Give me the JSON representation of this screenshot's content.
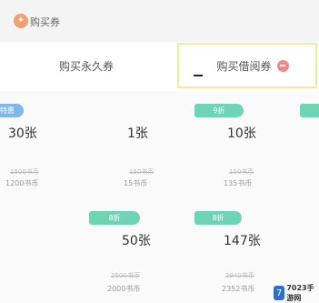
{
  "header": {
    "icon_glyph": "✦",
    "title": "购买券"
  },
  "tabs": [
    {
      "label": "购买永久券"
    },
    {
      "label": "购买借阅券"
    }
  ],
  "options": [
    {
      "badge": "特惠",
      "count": "30张",
      "original": "1500书币",
      "price": "1200书币"
    },
    {
      "badge": "",
      "count": "1张",
      "original": "150书币",
      "price": "15书币"
    },
    {
      "badge": "9折",
      "count": "10张",
      "original": "150书币",
      "price": "135书币"
    },
    {
      "badge": "",
      "count": "",
      "original": "",
      "price": ""
    },
    {
      "badge": "8折",
      "count": "50张",
      "original": "2500书币",
      "price": "2000书币"
    },
    {
      "badge": "8折",
      "count": "147张",
      "original": "2940书币",
      "price": "2352书币"
    }
  ],
  "watermark": {
    "icon_glyph": "7",
    "text": "7023手游网"
  },
  "colors": {
    "badge_green": "#6fd4b6",
    "badge_blue": "#7fb6ee",
    "tab_highlight": "#f2eb9a",
    "tab_badge": "#f08a8a"
  }
}
